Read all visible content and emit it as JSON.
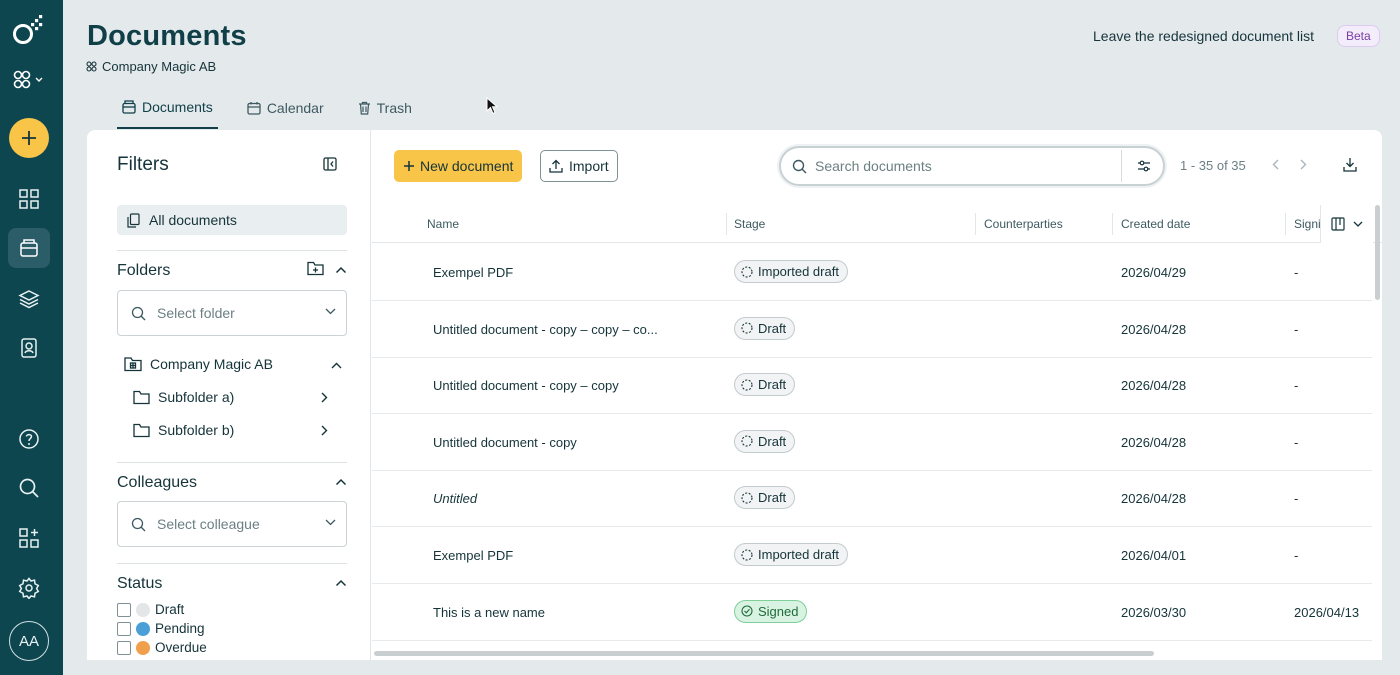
{
  "header": {
    "title": "Documents",
    "company": "Company Magic AB",
    "leave_link": "Leave the redesigned document list",
    "beta_badge": "Beta"
  },
  "tabs": [
    {
      "label": "Documents",
      "icon": "documents-icon",
      "active": true
    },
    {
      "label": "Calendar",
      "icon": "calendar-icon",
      "active": false
    },
    {
      "label": "Trash",
      "icon": "trash-icon",
      "active": false
    }
  ],
  "rail": {
    "avatar_initials": "AA",
    "icons": [
      "logo-icon",
      "workspace-switcher-icon",
      "create-icon",
      "dashboard-icon",
      "documents-icon",
      "templates-icon",
      "contacts-icon",
      "help-icon",
      "search-icon",
      "marketplace-icon",
      "settings-icon"
    ]
  },
  "filters": {
    "title": "Filters",
    "all_documents": "All documents",
    "folders": {
      "title": "Folders",
      "placeholder": "Select folder",
      "root": "Company Magic AB",
      "children": [
        "Subfolder a)",
        "Subfolder b)"
      ]
    },
    "colleagues": {
      "title": "Colleagues",
      "placeholder": "Select colleague"
    },
    "status": {
      "title": "Status",
      "items": [
        {
          "label": "Draft",
          "color": "#e3e6e7"
        },
        {
          "label": "Pending",
          "color": "#4a9fd6"
        },
        {
          "label": "Overdue",
          "color": "#f0a04b"
        }
      ]
    }
  },
  "toolbar": {
    "new_document": "New document",
    "import": "Import",
    "search_placeholder": "Search documents",
    "pager": "1 - 35 of 35"
  },
  "table": {
    "columns": [
      "Name",
      "Stage",
      "Counterparties",
      "Created date",
      "Signi"
    ],
    "rows": [
      {
        "name": "Exempel PDF",
        "stage": "Imported draft",
        "created": "2026/04/29",
        "signed": "-"
      },
      {
        "name": "Untitled document - copy – copy – co...",
        "stage": "Draft",
        "created": "2026/04/28",
        "signed": "-"
      },
      {
        "name": "Untitled document - copy – copy",
        "stage": "Draft",
        "created": "2026/04/28",
        "signed": "-"
      },
      {
        "name": "Untitled document - copy",
        "stage": "Draft",
        "created": "2026/04/28",
        "signed": "-"
      },
      {
        "name": "Untitled",
        "stage": "Draft",
        "created": "2026/04/28",
        "signed": "-"
      },
      {
        "name": "Exempel PDF",
        "stage": "Imported draft",
        "created": "2026/04/01",
        "signed": "-"
      },
      {
        "name": "This is a new name",
        "stage": "Signed",
        "created": "2026/03/30",
        "signed": "2026/04/13"
      }
    ]
  },
  "colors": {
    "rail": "#0e4650",
    "accent": "#f8c548",
    "signed": "#d9f3e2"
  }
}
